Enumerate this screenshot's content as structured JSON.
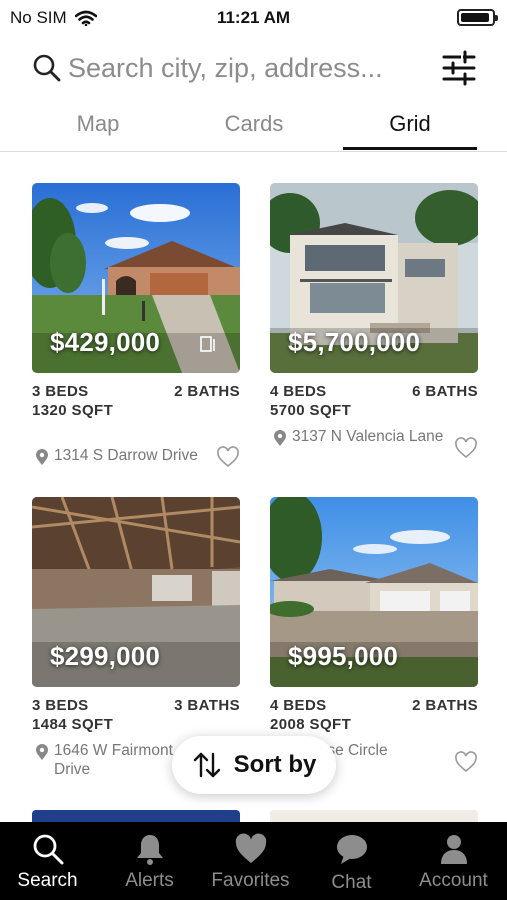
{
  "status_bar": {
    "carrier": "No SIM",
    "time": "11:21 AM"
  },
  "search": {
    "placeholder": "Search city, zip, address..."
  },
  "tabs": [
    {
      "label": "Map",
      "active": false
    },
    {
      "label": "Cards",
      "active": false
    },
    {
      "label": "Grid",
      "active": true
    }
  ],
  "listings": [
    {
      "price": "$429,000",
      "beds": "3 BEDS",
      "baths": "2 BATHS",
      "sqft": "1320 SQFT",
      "address": "1314 S Darrow Drive"
    },
    {
      "price": "$5,700,000",
      "beds": "4 BEDS",
      "baths": "6 BATHS",
      "sqft": "5700 SQFT",
      "address": "3137 N Valencia Lane"
    },
    {
      "price": "$299,000",
      "beds": "3 BEDS",
      "baths": "3 BATHS",
      "sqft": "1484 SQFT",
      "address": "1646 W Fairmont Drive"
    },
    {
      "price": "$995,000",
      "beds": "4 BEDS",
      "baths": "2 BATHS",
      "sqft": "2008 SQFT",
      "address": "N Rose Circle"
    }
  ],
  "sort_button": {
    "label": "Sort by"
  },
  "tabbar": [
    {
      "label": "Search",
      "icon": "search-icon",
      "active": true
    },
    {
      "label": "Alerts",
      "icon": "bell-icon",
      "active": false
    },
    {
      "label": "Favorites",
      "icon": "heart-icon",
      "active": false
    },
    {
      "label": "Chat",
      "icon": "chat-bubble-icon",
      "active": false
    },
    {
      "label": "Account",
      "icon": "person-icon",
      "active": false
    }
  ],
  "colors": {
    "accent": "#111111",
    "tabbar_bg": "#000000",
    "inactive": "#8d8d8d",
    "muted_text": "#777777"
  }
}
